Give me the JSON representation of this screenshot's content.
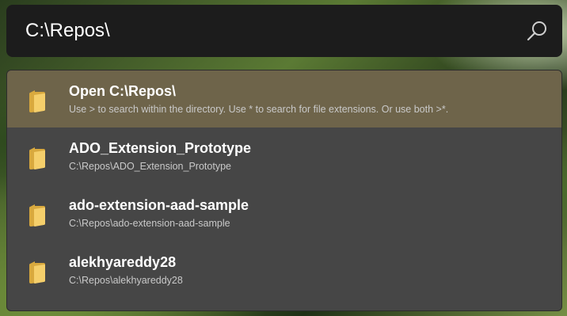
{
  "search": {
    "value": "C:\\Repos\\",
    "search_icon": "search-icon"
  },
  "results": [
    {
      "title": "Open C:\\Repos\\",
      "subtitle": "Use > to search within the directory. Use * to search for file extensions. Or use both >*.",
      "icon": "folder-icon",
      "selected": true
    },
    {
      "title": "ADO_Extension_Prototype",
      "subtitle": "C:\\Repos\\ADO_Extension_Prototype",
      "icon": "folder-icon",
      "selected": false
    },
    {
      "title": "ado-extension-aad-sample",
      "subtitle": "C:\\Repos\\ado-extension-aad-sample",
      "icon": "folder-icon",
      "selected": false
    },
    {
      "title": "alekhyareddy28",
      "subtitle": "C:\\Repos\\alekhyareddy28",
      "icon": "folder-icon",
      "selected": false
    }
  ],
  "colors": {
    "search_bg": "#1c1c1c",
    "list_bg": "#464646",
    "selected_bg": "#6e644a",
    "folder_yellow": "#f5cf6b"
  }
}
